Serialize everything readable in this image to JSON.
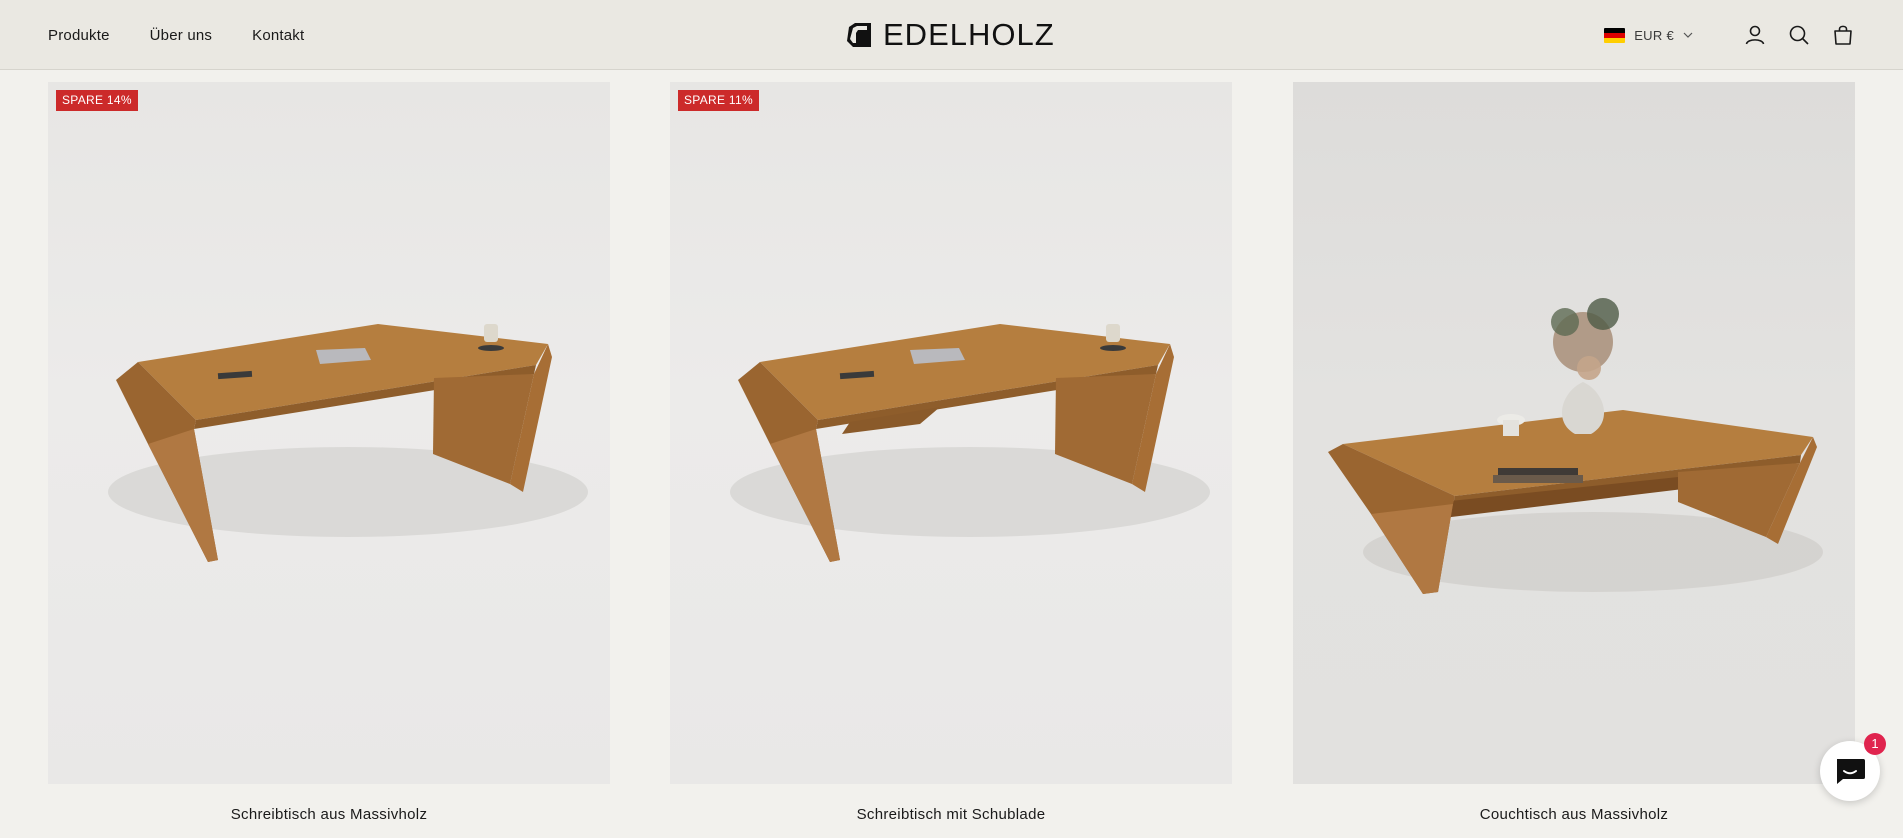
{
  "header": {
    "nav": [
      {
        "label": "Produkte"
      },
      {
        "label": "Über uns"
      },
      {
        "label": "Kontakt"
      }
    ],
    "logo_text": "EDELHOLZ",
    "currency_label": "EUR €",
    "flag": {
      "colors": [
        "#000000",
        "#dd0000",
        "#ffce00"
      ],
      "country": "germany-flag-icon"
    }
  },
  "products": [
    {
      "title": "Schreibtisch aus Massivholz",
      "badge": "SPARE 14%"
    },
    {
      "title": "Schreibtisch mit Schublade",
      "badge": "SPARE 11%"
    },
    {
      "title": "Couchtisch aus Massivholz",
      "badge": ""
    }
  ],
  "chat": {
    "badge_count": "1"
  },
  "colors": {
    "sale_badge": "#cc2a2a",
    "wood": "#b47c3c",
    "chat_badge": "#e0244e",
    "header_bg": "#eae8e2"
  }
}
